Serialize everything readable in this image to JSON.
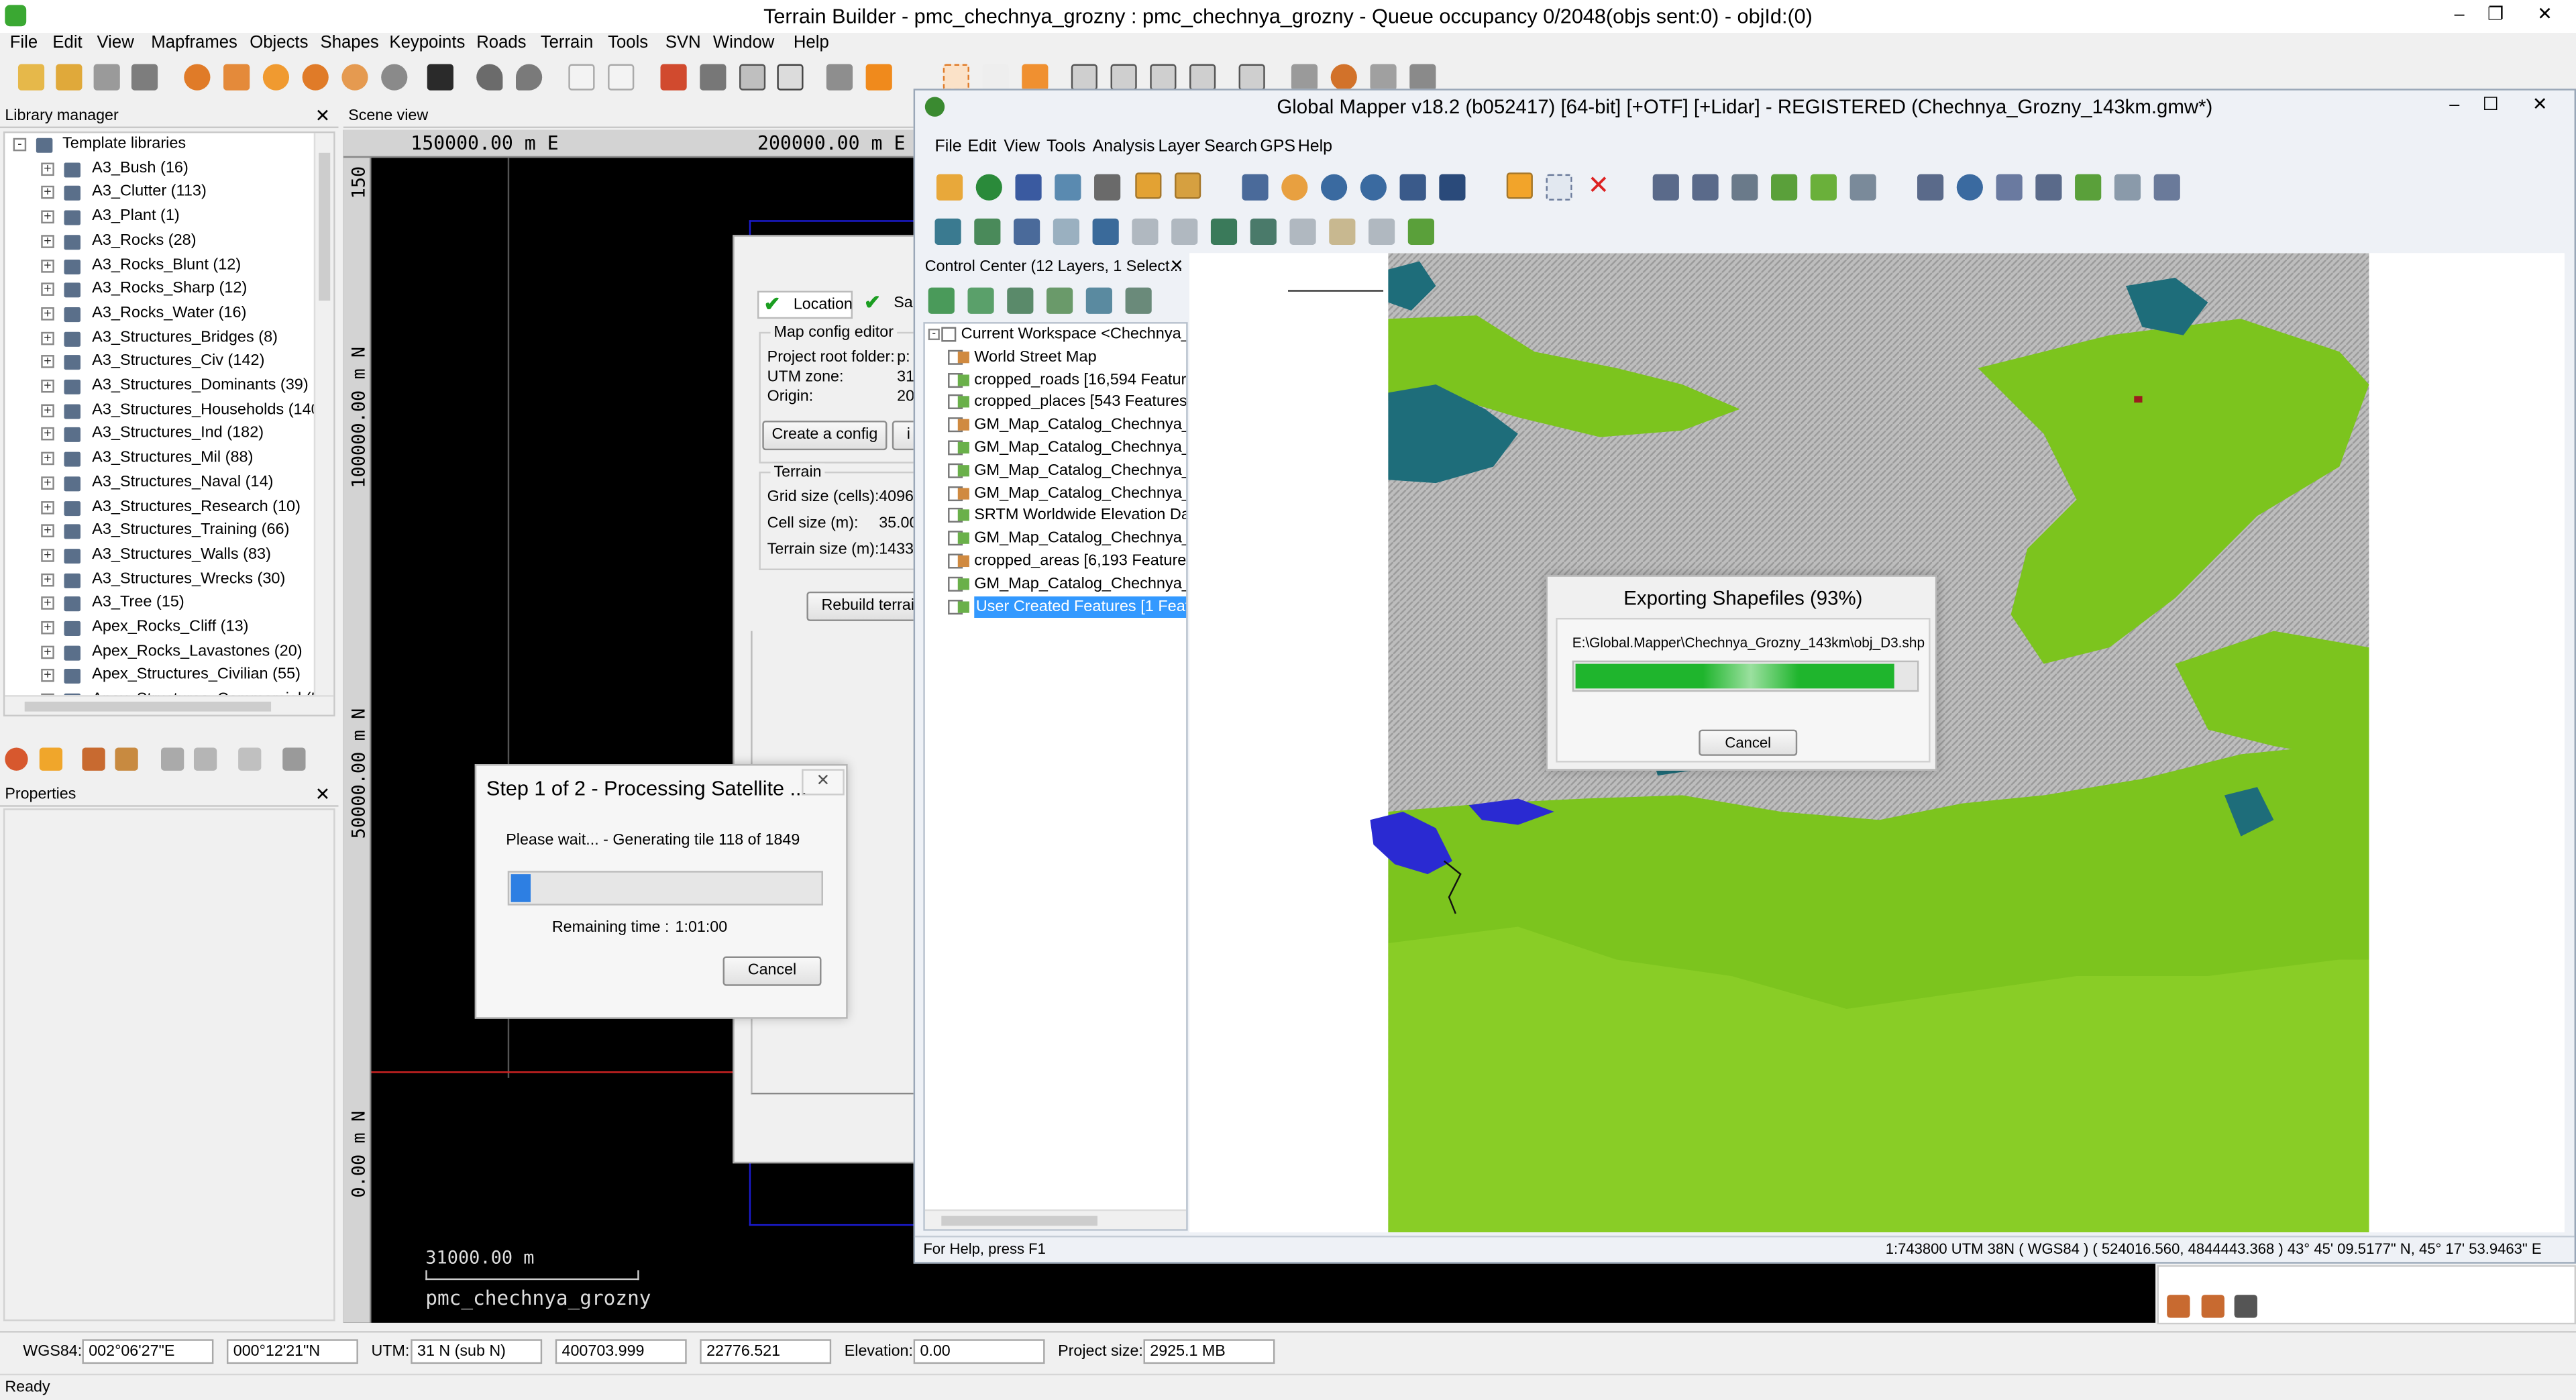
{
  "tb": {
    "title": "Terrain Builder - pmc_chechnya_grozny : pmc_chechnya_grozny - Queue occupancy 0/2048(objs sent:0) - objId:(0)",
    "menu": [
      "File",
      "Edit",
      "View",
      "Mapframes",
      "Objects",
      "Shapes",
      "Keypoints",
      "Roads",
      "Terrain",
      "Tools",
      "SVN",
      "Window",
      "Help"
    ]
  },
  "library": {
    "header": "Library manager",
    "root": "Template libraries",
    "items": [
      "A3_Bush (16)",
      "A3_Clutter (113)",
      "A3_Plant (1)",
      "A3_Rocks (28)",
      "A3_Rocks_Blunt (12)",
      "A3_Rocks_Sharp (12)",
      "A3_Rocks_Water (16)",
      "A3_Structures_Bridges (8)",
      "A3_Structures_Civ (142)",
      "A3_Structures_Dominants (39)",
      "A3_Structures_Households (140",
      "A3_Structures_Ind (182)",
      "A3_Structures_Mil (88)",
      "A3_Structures_Naval (14)",
      "A3_Structures_Research (10)",
      "A3_Structures_Training (66)",
      "A3_Structures_Walls (83)",
      "A3_Structures_Wrecks (30)",
      "A3_Tree (15)",
      "Apex_Rocks_Cliff (13)",
      "Apex_Rocks_Lavastones (20)",
      "Apex_Structures_Civilian (55)",
      "Apex_Structures_Commercial (5"
    ]
  },
  "properties": {
    "header": "Properties"
  },
  "scene": {
    "header": "Scene view",
    "ruler_top": [
      "150000.00 m E",
      "200000.00 m E"
    ],
    "ruler_left": [
      "150",
      "100000.00 m N",
      "50000.00 m N",
      "0.00 m N"
    ],
    "scale_text": "31000.00 m",
    "project_name": "pmc_chechnya_grozny"
  },
  "mapconfig": {
    "tabs": [
      "Location",
      "Sa"
    ],
    "group_title": "Map config editor",
    "rows": [
      {
        "label": "Project root folder:",
        "value": "p:"
      },
      {
        "label": "UTM zone:",
        "value": "31"
      },
      {
        "label": "Origin:",
        "value": "20"
      }
    ],
    "create_btn": "Create a config",
    "import_btn": "i",
    "terrain_title": "Terrain",
    "terrain_rows": [
      {
        "label": "Grid size (cells):",
        "value": "4096"
      },
      {
        "label": "Cell size (m):",
        "value": "35.00"
      },
      {
        "label": "Terrain size (m):",
        "value": "1433"
      }
    ],
    "rebuild_btn": "Rebuild terrain"
  },
  "processing": {
    "title": "Step 1 of 2 - Processing Satellite ...",
    "message": "Please wait... - Generating tile 118 of 1849",
    "progress": 0.064,
    "remaining_label": "Remaining time :",
    "remaining_value": "1:01:00",
    "cancel": "Cancel"
  },
  "gm": {
    "title": "Global Mapper v18.2 (b052417) [64-bit] [+OTF] [+Lidar] - REGISTERED (Chechnya_Grozny_143km.gmw*)",
    "menu": [
      "File",
      "Edit",
      "View",
      "Tools",
      "Analysis",
      "Layer",
      "Search",
      "GPS",
      "Help"
    ],
    "cc_title": "Control Center (12 Layers, 1 Select...",
    "workspace": "Current Workspace <Chechnya_",
    "layers": [
      "World Street Map",
      "cropped_roads [16,594 Featur",
      "cropped_places [543 Features",
      "GM_Map_Catalog_Chechnya_",
      "GM_Map_Catalog_Chechnya_",
      "GM_Map_Catalog_Chechnya_",
      "GM_Map_Catalog_Chechnya_",
      "SRTM Worldwide Elevation Da",
      "GM_Map_Catalog_Chechnya_",
      "cropped_areas [6,193 Features",
      "GM_Map_Catalog_Chechnya_",
      "User Created Features [1 Feat"
    ],
    "status_left": "For Help, press F1",
    "status_right": "1:743800 UTM 38N ( WGS84 ) ( 524016.560, 4844443.368 ) 43° 45' 09.5177\" N, 45° 17' 53.9463\" E"
  },
  "export": {
    "title": "Exporting Shapefiles (93%)",
    "path": "E:\\Global.Mapper\\Chechnya_Grozny_143km\\obj_D3.shp",
    "progress": 0.93,
    "cancel": "Cancel"
  },
  "statusbar": {
    "wgs_label": "WGS84:",
    "lat": "002°06'27\"E",
    "lon": "000°12'21\"N",
    "utm_label": "UTM:",
    "utm_zone": "31 N (sub N)",
    "easting": "400703.999",
    "northing": "22776.521",
    "elev_label": "Elevation:",
    "elevation": "0.00",
    "size_label": "Project size:",
    "size": "2925.1 MB",
    "ready": "Ready"
  },
  "colors": {
    "progress_green": "#1fb52d",
    "progress_blue": "#2d7fe3",
    "selection": "#3399ff",
    "veg": "#7cc41e",
    "teal": "#1e6d7a",
    "water": "#2a2ad2"
  }
}
